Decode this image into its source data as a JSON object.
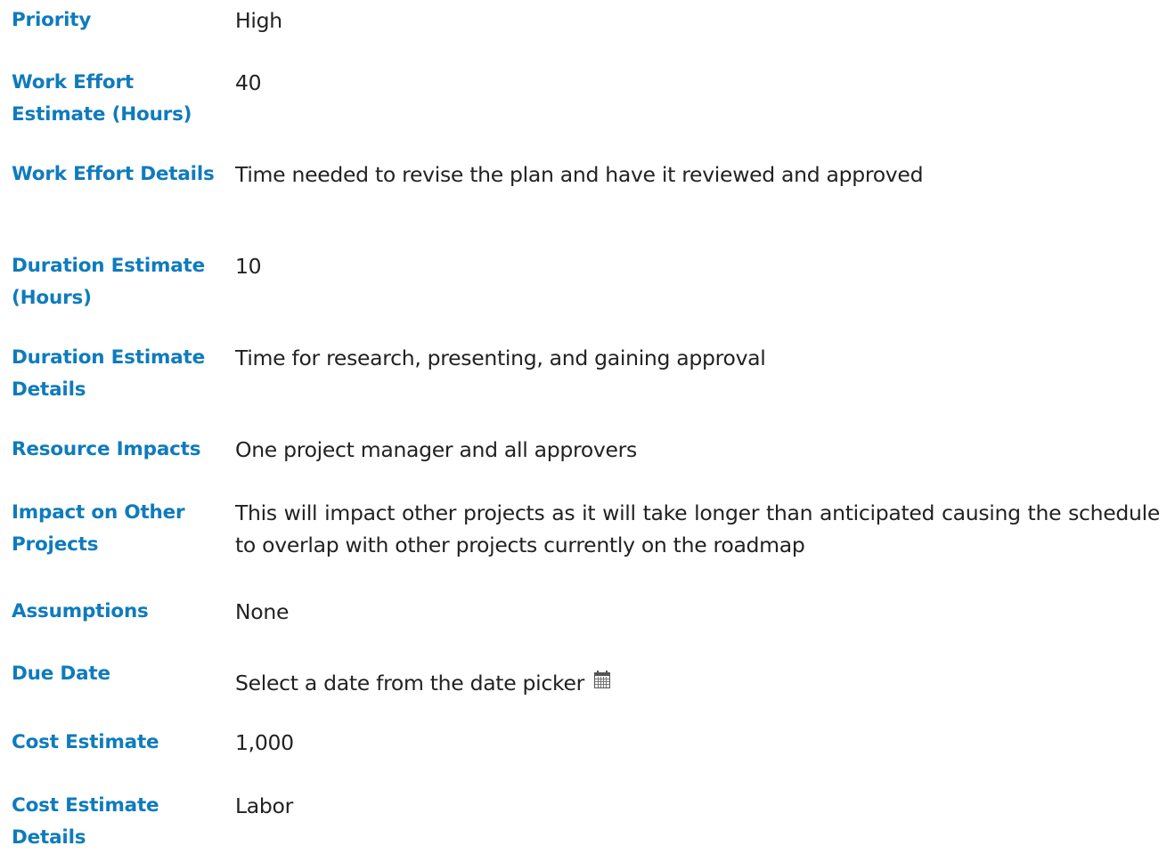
{
  "fields": {
    "priority": {
      "label": "Priority",
      "value": "High"
    },
    "work_effort_estimate": {
      "label": "Work Effort Estimate (Hours)",
      "value": "40"
    },
    "work_effort_details": {
      "label": "Work Effort Details",
      "value": "Time needed to revise the plan and have it reviewed and approved"
    },
    "duration_estimate": {
      "label": "Duration Estimate (Hours)",
      "value": "10"
    },
    "duration_estimate_details": {
      "label": "Duration Estimate Details",
      "value": "Time for research, presenting, and gaining approval"
    },
    "resource_impacts": {
      "label": "Resource Impacts",
      "value": "One project manager and all approvers"
    },
    "impact_on_other_projects": {
      "label": "Impact on Other Projects",
      "value": "This will impact other projects as it will take longer than anticipated causing the schedule to overlap with other projects currently on the roadmap"
    },
    "assumptions": {
      "label": "Assumptions",
      "value": "None"
    },
    "due_date": {
      "label": "Due Date",
      "placeholder": "Select a date from the date picker",
      "icon": "calendar-icon"
    },
    "cost_estimate": {
      "label": "Cost Estimate",
      "value": "1,000"
    },
    "cost_estimate_details": {
      "label": "Cost Estimate Details",
      "value": "Labor"
    }
  },
  "colors": {
    "label": "#0f7bbd",
    "value": "#222222",
    "background": "#ffffff"
  }
}
